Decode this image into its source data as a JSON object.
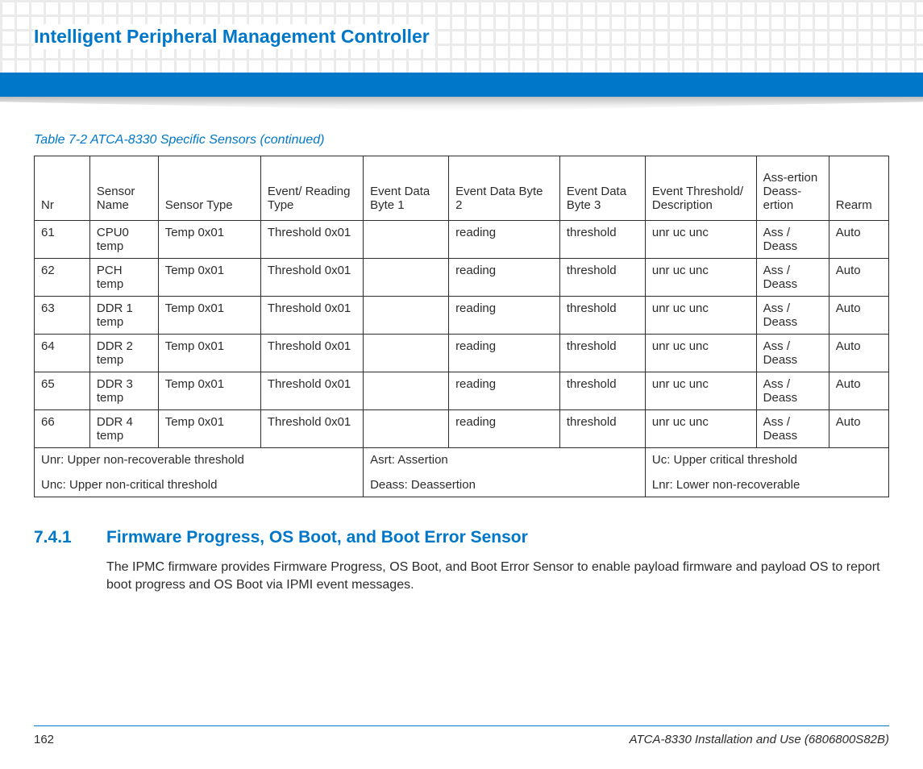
{
  "header": {
    "chapter_title": "Intelligent Peripheral Management Controller"
  },
  "table": {
    "caption": "Table 7-2 ATCA-8330 Specific Sensors (continued)",
    "headers": {
      "nr": "Nr",
      "sensor_name": "Sensor Name",
      "sensor_type": "Sensor Type",
      "event_reading_type": "Event/ Reading Type",
      "byte1": "Event Data Byte 1",
      "byte2": "Event Data Byte 2",
      "byte3": "Event Data Byte 3",
      "desc": "Event Threshold/ Description",
      "assertion": "Ass-ertion Deass-ertion",
      "rearm": "Rearm"
    },
    "rows": [
      {
        "nr": "61",
        "name": "CPU0 temp",
        "type": "Temp 0x01",
        "ert": "Threshold 0x01",
        "b1": "",
        "b2": "reading",
        "b3": "threshold",
        "desc": "unr uc unc",
        "ass": "Ass / Deass",
        "rearm": "Auto"
      },
      {
        "nr": "62",
        "name": "PCH temp",
        "type": "Temp 0x01",
        "ert": "Threshold 0x01",
        "b1": "",
        "b2": "reading",
        "b3": "threshold",
        "desc": "unr uc unc",
        "ass": "Ass / Deass",
        "rearm": "Auto"
      },
      {
        "nr": "63",
        "name": "DDR 1 temp",
        "type": "Temp 0x01",
        "ert": "Threshold 0x01",
        "b1": "",
        "b2": "reading",
        "b3": "threshold",
        "desc": "unr uc unc",
        "ass": "Ass / Deass",
        "rearm": "Auto"
      },
      {
        "nr": "64",
        "name": "DDR 2 temp",
        "type": "Temp 0x01",
        "ert": "Threshold 0x01",
        "b1": "",
        "b2": "reading",
        "b3": "threshold",
        "desc": "unr uc unc",
        "ass": "Ass / Deass",
        "rearm": "Auto"
      },
      {
        "nr": "65",
        "name": "DDR 3 temp",
        "type": "Temp 0x01",
        "ert": "Threshold 0x01",
        "b1": "",
        "b2": "reading",
        "b3": "threshold",
        "desc": "unr uc unc",
        "ass": "Ass / Deass",
        "rearm": "Auto"
      },
      {
        "nr": "66",
        "name": "DDR 4 temp",
        "type": "Temp 0x01",
        "ert": "Threshold 0x01",
        "b1": "",
        "b2": "reading",
        "b3": "threshold",
        "desc": "unr uc unc",
        "ass": "Ass / Deass",
        "rearm": "Auto"
      }
    ],
    "legend": {
      "c1a": "Unr: Upper non-recoverable threshold",
      "c1b": "Unc: Upper non-critical threshold",
      "c2a": "Asrt: Assertion",
      "c2b": "Deass: Deassertion",
      "c3a": "Uc: Upper critical threshold",
      "c3b": "Lnr: Lower non-recoverable"
    }
  },
  "section": {
    "number": "7.4.1",
    "title": "Firmware Progress, OS Boot, and Boot Error Sensor",
    "body": "The IPMC firmware provides Firmware Progress, OS Boot, and Boot Error Sensor to enable payload firmware and payload OS to report boot progress and OS Boot via IPMI event messages."
  },
  "footer": {
    "page": "162",
    "doc": "ATCA-8330 Installation and Use (6806800S82B)"
  }
}
